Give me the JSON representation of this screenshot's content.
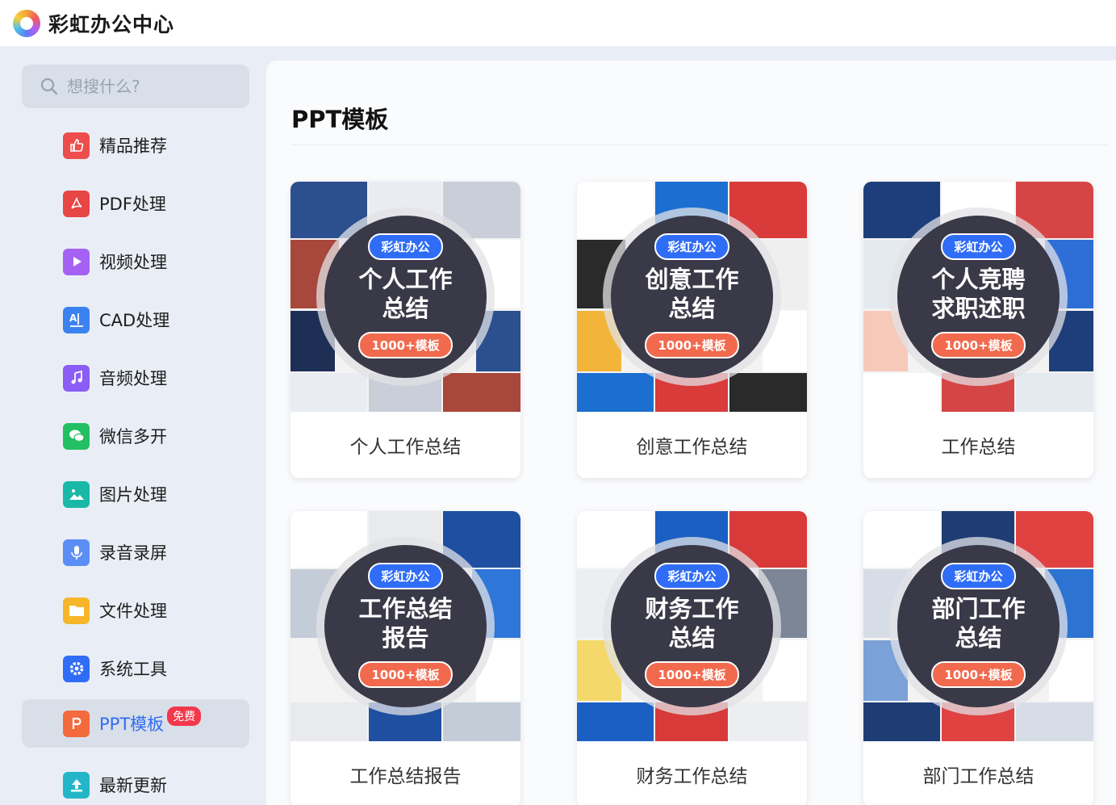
{
  "app": {
    "title": "彩虹办公中心"
  },
  "search": {
    "placeholder": "想搜什么?"
  },
  "sidebar": {
    "items": [
      {
        "label": "精品推荐",
        "icon": "thumbs-up-icon",
        "color": "#ee4d4d"
      },
      {
        "label": "PDF处理",
        "icon": "pdf-icon",
        "color": "#e84545"
      },
      {
        "label": "视频处理",
        "icon": "play-icon",
        "color": "#a461f2"
      },
      {
        "label": "CAD处理",
        "icon": "cad-icon",
        "color": "#3b82f0"
      },
      {
        "label": "音频处理",
        "icon": "music-icon",
        "color": "#8b5cf6"
      },
      {
        "label": "微信多开",
        "icon": "wechat-icon",
        "color": "#23c063"
      },
      {
        "label": "图片处理",
        "icon": "image-icon",
        "color": "#19b8a8"
      },
      {
        "label": "录音录屏",
        "icon": "microphone-icon",
        "color": "#5b8ef5"
      },
      {
        "label": "文件处理",
        "icon": "folder-icon",
        "color": "#f7b52a"
      },
      {
        "label": "系统工具",
        "icon": "gear-icon",
        "color": "#2f6df6"
      },
      {
        "label": "PPT模板",
        "icon": "ppt-icon",
        "color": "#f36a3d",
        "active": true,
        "badge": "免费"
      },
      {
        "label": "最新更新",
        "icon": "upload-icon",
        "color": "#22b6c8"
      }
    ]
  },
  "main": {
    "title": "PPT模板",
    "cards": [
      {
        "brand": "彩虹办公",
        "title_line1": "个人工作",
        "title_line2": "总结",
        "count": "1000+模板",
        "label": "个人工作总结"
      },
      {
        "brand": "彩虹办公",
        "title_line1": "创意工作",
        "title_line2": "总结",
        "count": "1000+模板",
        "label": "创意工作总结"
      },
      {
        "brand": "彩虹办公",
        "title_line1": "个人竞聘",
        "title_line2": "求职述职",
        "count": "1000+模板",
        "label": "工作总结"
      },
      {
        "brand": "彩虹办公",
        "title_line1": "工作总结",
        "title_line2": "报告",
        "count": "1000+模板",
        "label": "工作总结报告"
      },
      {
        "brand": "彩虹办公",
        "title_line1": "财务工作",
        "title_line2": "总结",
        "count": "1000+模板",
        "label": "财务工作总结"
      },
      {
        "brand": "彩虹办公",
        "title_line1": "部门工作",
        "title_line2": "总结",
        "count": "1000+模板",
        "label": "部门工作总结"
      }
    ]
  },
  "colors": {
    "accent": "#2f6df6",
    "badge": "#f2394b",
    "disc": "#3a3948",
    "count_pill": "#f26a4e"
  }
}
